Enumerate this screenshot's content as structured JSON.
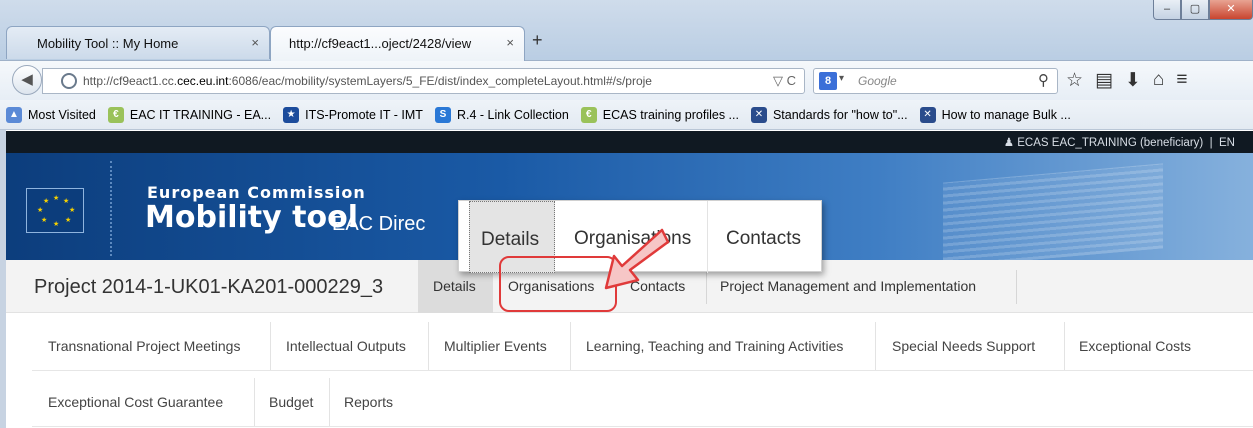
{
  "browser": {
    "tabs": [
      {
        "title": "Mobility Tool :: My Home",
        "close": "×"
      },
      {
        "title": "http://cf9eact1...oject/2428/view",
        "close": "×"
      }
    ],
    "new_tab": "+",
    "window_buttons": {
      "minimize": "–",
      "maximize": "▢",
      "close": "✕"
    },
    "url_prefix": "http://cf9eact1.cc.",
    "url_domain": "cec.eu.int",
    "url_rest": ":6086/eac/mobility/systemLayers/5_FE/dist/index_completeLayout.html#/s/proje",
    "url_icons": "▽ C",
    "search_engine_icon": "8",
    "search_caret": "▾",
    "search_placeholder": "Google",
    "bookmarks": [
      {
        "label": "Most Visited",
        "icon_color": "#5b8ad6",
        "icon_glyph": "▲"
      },
      {
        "label": "EAC IT TRAINING - EA...",
        "icon_color": "#9ac25a",
        "icon_glyph": "€"
      },
      {
        "label": "ITS-Promote IT - IMT",
        "icon_color": "#1c4c9c",
        "icon_glyph": "★"
      },
      {
        "label": "R.4 - Link Collection",
        "icon_color": "#2a78d6",
        "icon_glyph": "S"
      },
      {
        "label": "ECAS training profiles ...",
        "icon_color": "#9ac25a",
        "icon_glyph": "€"
      },
      {
        "label": "Standards for \"how to\"...",
        "icon_color": "#2a4c8c",
        "icon_glyph": "✕"
      },
      {
        "label": "How to manage Bulk ...",
        "icon_color": "#2a4c8c",
        "icon_glyph": "✕"
      }
    ],
    "accent_color": "#1c4c9c"
  },
  "header": {
    "user": "ECAS EAC_TRAINING (beneficiary)",
    "user_sep": "|",
    "lang": "EN",
    "org": "European Commission",
    "app": "Mobility tool",
    "dg": "EAC Direc"
  },
  "project": {
    "title": "Project 2014-1-UK01-KA201-000229_3",
    "tabs": [
      "Details",
      "Organisations",
      "Contacts",
      "Project Management and Implementation"
    ],
    "active_tab": "Details"
  },
  "submenu": {
    "row1": [
      "Transnational Project Meetings",
      "Intellectual Outputs",
      "Multiplier Events",
      "Learning, Teaching and Training Activities",
      "Special Needs Support",
      "Exceptional Costs"
    ],
    "row2": [
      "Exceptional Cost Guarantee",
      "Budget",
      "Reports"
    ]
  },
  "callout": {
    "tabs": [
      "Details",
      "Organisations",
      "Contacts"
    ],
    "highlight_color": "#e03a3a"
  }
}
